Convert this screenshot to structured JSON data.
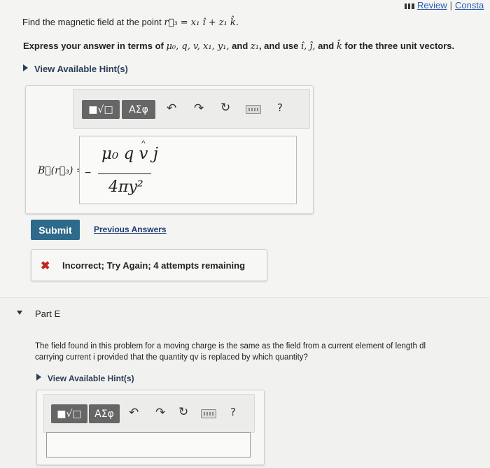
{
  "header": {
    "review_label": "Review",
    "separator": "|",
    "constants_label": "Consta"
  },
  "question": {
    "prefix": "Find the magnetic field at the point ",
    "math": "r⃗₃ = x₁ î + z₁ k̂."
  },
  "instruction": {
    "text_a": "Express your answer in terms of ",
    "vars": "μ₀, q, v, x₁, y₁,",
    "text_b": " and ",
    "z1": "z₁",
    "text_c": ", and use ",
    "units": "î, ĵ,",
    "text_d": " and ",
    "k": "k̂",
    "text_e": " for the three unit vectors."
  },
  "hint_label": "View Available Hint(s)",
  "toolbar": {
    "matrix_button": "■√□",
    "greek_button": "ΑΣφ",
    "undo_icon": "↶",
    "redo_icon": "↷",
    "reset_icon": "↻",
    "keyboard_icon": "keyboard-icon",
    "help_label": "?"
  },
  "equation": {
    "label": "B⃗(r⃗₃) =",
    "minus": "−",
    "numerator": "μ₀ q v j",
    "hat": "^",
    "denominator": "4πy²"
  },
  "submit_label": "Submit",
  "previous_answers_label": "Previous Answers",
  "feedback": {
    "icon": "✖",
    "text": "Incorrect; Try Again; 4 attempts remaining"
  },
  "part_e": {
    "title": "Part E",
    "question_line1": "The field found in this problem for a moving charge is the same as the field from a current element of length dl",
    "question_line2": "carrying current i provided that the quantity qv is replaced by which quantity?",
    "hint_label": "View Available Hint(s)"
  },
  "colors": {
    "submit": "#2e6a8c",
    "link": "#1d3a70",
    "error": "#c0271c"
  }
}
